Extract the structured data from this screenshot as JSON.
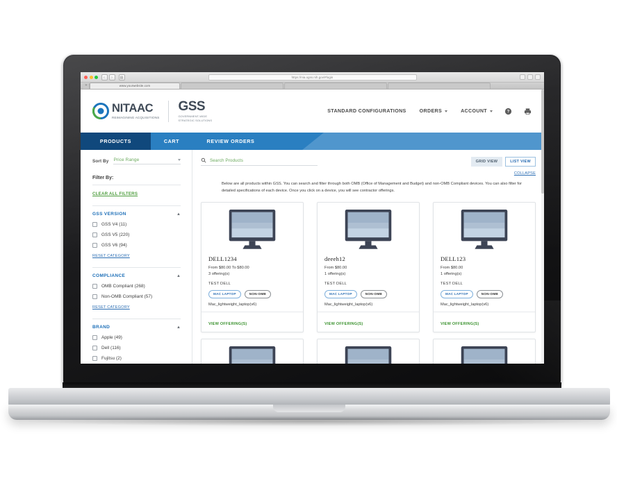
{
  "browser": {
    "url": "https://nia.ogss.nih.gov/#login",
    "tab_title": "www.yourwebsite.com",
    "new_tab_label": "+",
    "back_label": "‹",
    "forward_label": "›",
    "sidebar_toggle_label": "▤"
  },
  "header": {
    "nitaac_word": "NITAAC",
    "nitaac_tagline": "REIMAGINING ACQUISITIONS",
    "gss_word": "GSS",
    "gss_tagline_line1": "GOVERNMENT-WIDE",
    "gss_tagline_line2": "STRATEGIC SOLUTIONS",
    "nav": [
      {
        "label": "STANDARD CONFIGURATIONS",
        "has_caret": false
      },
      {
        "label": "ORDERS",
        "has_caret": true
      },
      {
        "label": "ACCOUNT",
        "has_caret": true
      }
    ],
    "help_icon": "help-circle-icon",
    "print_icon": "printer-icon"
  },
  "main_nav": {
    "tabs": [
      {
        "label": "PRODUCTS",
        "active": true
      },
      {
        "label": "CART",
        "active": false
      },
      {
        "label": "REVIEW ORDERS",
        "active": false
      }
    ],
    "color_active": "#10487c",
    "color_dark": "#2a7fc1",
    "color_light": "#5096cd"
  },
  "sidebar": {
    "sort_label": "Sort By",
    "sort_value": "Price Range",
    "filter_by_label": "Filter By:",
    "clear_all_label": "CLEAR ALL FILTERS",
    "reset_category_label": "RESET CATEGORY",
    "facets": [
      {
        "title": "GSS VERSION",
        "options": [
          {
            "label": "GSS V4 (11)"
          },
          {
            "label": "GSS V5 (220)"
          },
          {
            "label": "GSS V6 (94)"
          }
        ]
      },
      {
        "title": "COMPLIANCE",
        "options": [
          {
            "label": "OMB Compliant (268)"
          },
          {
            "label": "Non-OMB Compliant (57)"
          }
        ]
      },
      {
        "title": "BRAND",
        "options": [
          {
            "label": "Apple (49)"
          },
          {
            "label": "Dell (116)"
          },
          {
            "label": "Fujitsu (2)"
          }
        ]
      }
    ]
  },
  "main": {
    "search_placeholder": "Search Products",
    "search_icon": "search-icon",
    "grid_view_label": "GRID VIEW",
    "list_view_label": "LIST VIEW",
    "collapse_label": "COLLAPSE",
    "intro_text": "Below are all products within GSS. You can search and filter through both OMB (Office of Management and Budget) and non-OMB Compliant devices. You can also filter for detailed specifications of each device. Once you click on a device, you will see contractor offerings.",
    "view_offerings_label": "VIEW OFFERING(S)",
    "products": [
      {
        "title": "DELL1234",
        "price": "From $80.00 To $80.00",
        "offerings": "3 offering(s)",
        "vendor": "TEST DELL",
        "badge_primary": "MAC LAPTOP",
        "badge_secondary": "NON-OMB",
        "spec": "Mac_lightweight_laptop(v6)",
        "cta": "VIEW OFFERING(S)"
      },
      {
        "title": "deeeh12",
        "price": "From $80.00",
        "offerings": "1 offering(s)",
        "vendor": "TEST DELL",
        "badge_primary": "MAC LAPTOP",
        "badge_secondary": "NON-OMB",
        "spec": "Mac_lightweight_laptop(v6)",
        "cta": "VIEW OFFERING(S)"
      },
      {
        "title": "DELL123",
        "price": "From $80.00",
        "offerings": "1 offering(s)",
        "vendor": "TEST DELL",
        "badge_primary": "MAC LAPTOP",
        "badge_secondary": "NON-OMB",
        "spec": "Mac_lightweight_laptop(v6)",
        "cta": "VIEW OFFERING(S)"
      }
    ]
  },
  "colors": {
    "brand_blue": "#2a6db3",
    "nav_blue": "#2a7fc1",
    "nav_blue_light": "#5096cd",
    "nav_blue_dark": "#10487c",
    "accent_green": "#4f9e3f",
    "text_dark": "#3d3d3d"
  }
}
